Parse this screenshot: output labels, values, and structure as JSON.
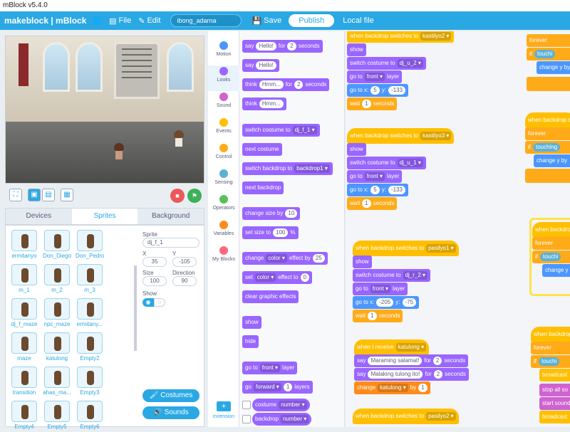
{
  "window_title": "mBlock v5.4.0",
  "menu": {
    "logo": "makeblock | mBlock",
    "file": "File",
    "edit": "Edit",
    "project_name": "ibong_adarna",
    "save": "Save",
    "publish": "Publish",
    "local_file": "Local file"
  },
  "tabs": {
    "devices": "Devices",
    "sprites": "Sprites",
    "background": "Background"
  },
  "sprites": [
    {
      "name": "ermitanyo"
    },
    {
      "name": "Don_Diego"
    },
    {
      "name": "Don_Pedro"
    },
    {
      "name": "m_1"
    },
    {
      "name": "m_2"
    },
    {
      "name": "m_3"
    },
    {
      "name": "dj_f_maze"
    },
    {
      "name": "npc_maze"
    },
    {
      "name": "ermitany..."
    },
    {
      "name": "maze"
    },
    {
      "name": "katulong"
    },
    {
      "name": "Empty2"
    },
    {
      "name": "transition"
    },
    {
      "name": "ahas_ma..."
    },
    {
      "name": "Empty3"
    },
    {
      "name": "Empty4"
    },
    {
      "name": "Empty5"
    },
    {
      "name": "Empty6"
    }
  ],
  "sprite_info": {
    "sprite_label": "Sprite",
    "sprite_name": "dj_f_1",
    "x_label": "X",
    "x": "35",
    "y_label": "Y",
    "y": "-105",
    "size_label": "Size",
    "size": "100",
    "direction_label": "Direction",
    "direction": "90",
    "show_label": "Show"
  },
  "buttons": {
    "costumes": "Costumes",
    "sounds": "Sounds"
  },
  "categories": [
    {
      "label": "Motion",
      "color": "#4c97ff"
    },
    {
      "label": "Looks",
      "color": "#9966ff"
    },
    {
      "label": "Sound",
      "color": "#cf63cf"
    },
    {
      "label": "Events",
      "color": "#ffbf00"
    },
    {
      "label": "Control",
      "color": "#ffab19"
    },
    {
      "label": "Sensing",
      "color": "#5cb1d6"
    },
    {
      "label": "Operators",
      "color": "#59c059"
    },
    {
      "label": "Variables",
      "color": "#ff8c1a"
    },
    {
      "label": "My Blocks",
      "color": "#ff6680"
    }
  ],
  "extension": "extension",
  "palette": {
    "say": "say",
    "hello": "Hello!",
    "for": "for",
    "two": "2",
    "seconds": "seconds",
    "think": "think",
    "hmm": "Hmm...",
    "switch_costume_to": "switch costume to",
    "dj_f_1": "dj_f_1 ▾",
    "next_costume": "next costume",
    "switch_backdrop_to": "switch backdrop to",
    "backdrop1": "backdrop1 ▾",
    "next_backdrop": "next backdrop",
    "change_size_by": "change size by",
    "ten": "10",
    "set_size_to": "set size to",
    "hundred": "100",
    "percent": "%",
    "change": "change",
    "color": "color ▾",
    "effect_by": "effect by",
    "twentyfive": "25",
    "set": "set",
    "effect_to": "effect to",
    "zero": "0",
    "clear_graphic_effects": "clear graphic effects",
    "show": "show",
    "hide": "hide",
    "go_to": "go to",
    "front": "front ▾",
    "layer": "layer",
    "go": "go",
    "forward": "forward ▾",
    "one": "1",
    "layers": "layers",
    "costume": "costume",
    "number": "number ▾",
    "backdrop": "backdrop"
  },
  "scripts": {
    "when_backdrop_switches_to": "when backdrop switches to",
    "kastilyo2": "kastilyo2 ▾",
    "kastilyo3": "kastilyo3 ▾",
    "pasilyo1": "pasilyo1 ▾",
    "pasilyo2": "pasilyo2 ▾",
    "show": "show",
    "switch_costume_to": "switch costume to",
    "dj_u_2": "dj_u_2 ▾",
    "dj_u_1": "dj_u_1 ▾",
    "dj_r_2": "dj_r_2 ▾",
    "go_to": "go to",
    "front": "front ▾",
    "layer": "layer",
    "go_to_x": "go to x:",
    "y": "y:",
    "x5": "5",
    "y_133": "-133",
    "x_205": "-205",
    "y_75": "-75",
    "wait": "wait",
    "one": "1",
    "seconds": "seconds",
    "when_i_receive": "when I receive",
    "katulong": "katulong ▾",
    "say": "say",
    "for": "for",
    "two": "2",
    "msg1": "Maraming salamat!",
    "msg2": "Malaking tulong ito!",
    "change": "change",
    "by": "by",
    "forever": "forever",
    "if": "if",
    "touching": "touchi",
    "touching2": "touching",
    "change_y_by": "change y by",
    "broadcast": "broadcast",
    "stop_all_sounds": "stop all so",
    "start_sound": "start sound"
  }
}
